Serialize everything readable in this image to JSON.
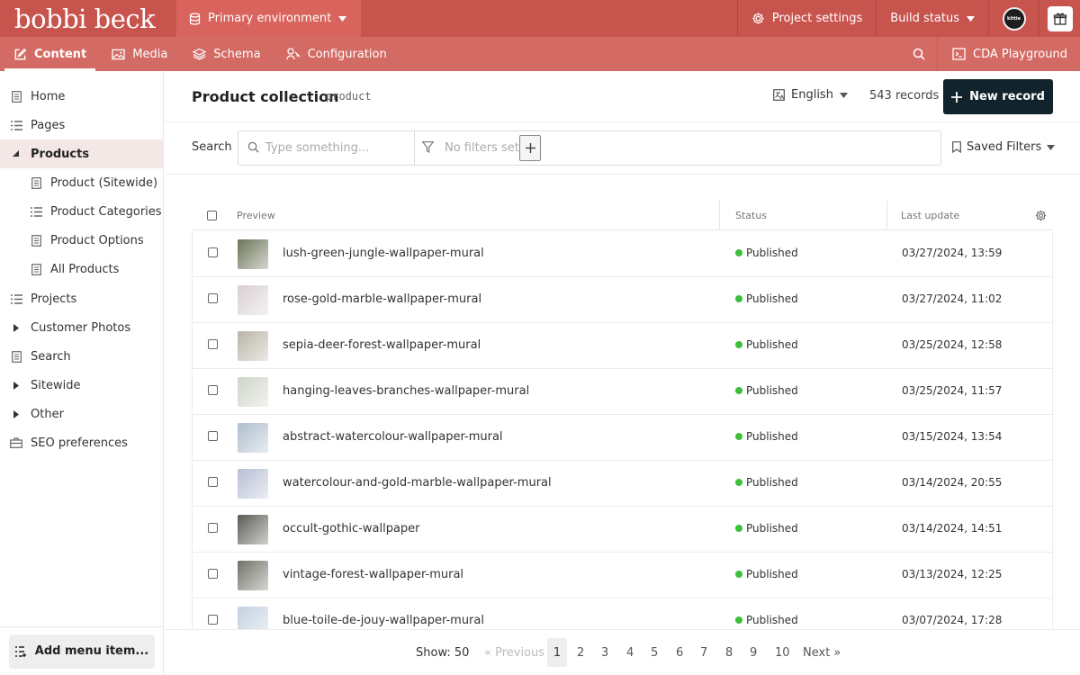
{
  "brand": {
    "logo_text": "bobbi beck",
    "color": "#c8544e"
  },
  "topbar": {
    "environment_label": "Primary environment",
    "project_settings_label": "Project settings",
    "build_status_label": "Build status",
    "avatar_text": "kittie"
  },
  "nav": {
    "tabs": [
      {
        "label": "Content",
        "icon": "edit-icon",
        "active": true
      },
      {
        "label": "Media",
        "icon": "image-icon",
        "active": false
      },
      {
        "label": "Schema",
        "icon": "layers-icon",
        "active": false
      },
      {
        "label": "Configuration",
        "icon": "config-icon",
        "active": false
      }
    ],
    "cda_label": "CDA Playground"
  },
  "sidebar": {
    "items": [
      {
        "label": "Home",
        "icon": "document-icon"
      },
      {
        "label": "Pages",
        "icon": "list-icon"
      },
      {
        "label": "Products",
        "icon": "caret-down-icon",
        "active": true
      },
      {
        "label": "Product (Sitewide)",
        "icon": "document-icon"
      },
      {
        "label": "Product Categories",
        "icon": "list-icon"
      },
      {
        "label": "Product Options",
        "icon": "document-icon"
      },
      {
        "label": "All Products",
        "icon": "document-icon"
      },
      {
        "label": "Projects",
        "icon": "list-icon"
      },
      {
        "label": "Customer Photos",
        "icon": "caret-right-icon"
      },
      {
        "label": "Search",
        "icon": "document-icon"
      },
      {
        "label": "Sitewide",
        "icon": "caret-right-icon"
      },
      {
        "label": "Other",
        "icon": "caret-right-icon"
      },
      {
        "label": "SEO preferences",
        "icon": "briefcase-icon"
      }
    ],
    "add_menu_label": "Add menu item..."
  },
  "main": {
    "title": "Product collection",
    "api_key": "product",
    "language": "English",
    "records_count": "543 records",
    "new_record_label": "New record",
    "search_label": "Search",
    "search_placeholder": "Type something...",
    "filters_text": "No filters set",
    "saved_filters_label": "Saved Filters"
  },
  "table": {
    "headers": {
      "preview": "Preview",
      "status": "Status",
      "last_update": "Last update"
    },
    "rows": [
      {
        "name": "lush-green-jungle-wallpaper-mural",
        "status": "Published",
        "date": "03/27/2024, 13:59",
        "thumb": "#6b7458"
      },
      {
        "name": "rose-gold-marble-wallpaper-mural",
        "status": "Published",
        "date": "03/27/2024, 11:02",
        "thumb": "#d9cfd2"
      },
      {
        "name": "sepia-deer-forest-wallpaper-mural",
        "status": "Published",
        "date": "03/25/2024, 12:58",
        "thumb": "#b9b4a6"
      },
      {
        "name": "hanging-leaves-branches-wallpaper-mural",
        "status": "Published",
        "date": "03/25/2024, 11:57",
        "thumb": "#cfd4c8"
      },
      {
        "name": "abstract-watercolour-wallpaper-mural",
        "status": "Published",
        "date": "03/15/2024, 13:54",
        "thumb": "#aebdcd"
      },
      {
        "name": "watercolour-and-gold-marble-wallpaper-mural",
        "status": "Published",
        "date": "03/14/2024, 20:55",
        "thumb": "#b6bfd4"
      },
      {
        "name": "occult-gothic-wallpaper",
        "status": "Published",
        "date": "03/14/2024, 14:51",
        "thumb": "#5b5b55"
      },
      {
        "name": "vintage-forest-wallpaper-mural",
        "status": "Published",
        "date": "03/13/2024, 12:25",
        "thumb": "#6f7366"
      },
      {
        "name": "blue-toile-de-jouy-wallpaper-mural",
        "status": "Published",
        "date": "03/07/2024, 17:28",
        "thumb": "#c3d0e0"
      }
    ],
    "status_color": "#3cbf3c"
  },
  "pagination": {
    "show_label": "Show: 50",
    "previous_label": "« Previous",
    "pages": [
      "1",
      "2",
      "3",
      "4",
      "5",
      "6",
      "7",
      "8",
      "9",
      "10"
    ],
    "current_page": "1",
    "next_label": "Next »"
  }
}
